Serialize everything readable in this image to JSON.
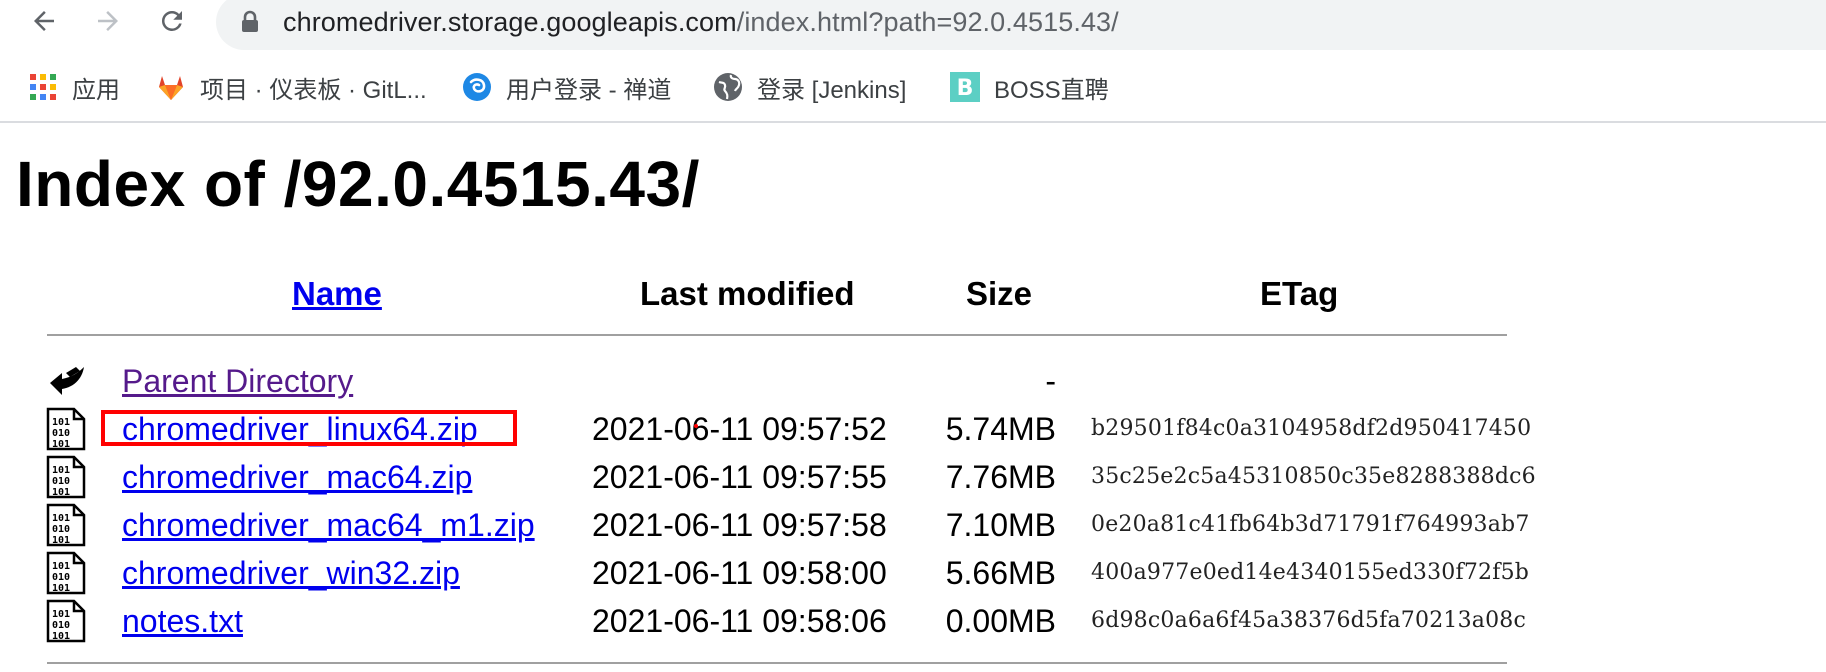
{
  "toolbar": {
    "back_icon": "arrow-left-icon",
    "forward_icon": "arrow-right-icon",
    "reload_icon": "reload-icon",
    "lock_icon": "lock-icon",
    "url_host": "chromedriver.storage.googleapis.com",
    "url_path": "/index.html?path=92.0.4515.43/"
  },
  "bookmarks": [
    {
      "label": "应用",
      "icon": "apps-grid-icon"
    },
    {
      "label": "项目 · 仪表板 · GitL...",
      "icon": "gitlab-icon"
    },
    {
      "label": "用户登录 - 禅道",
      "icon": "zentao-icon"
    },
    {
      "label": "登录 [Jenkins]",
      "icon": "globe-icon"
    },
    {
      "label": "BOSS直聘",
      "icon": "boss-icon"
    }
  ],
  "page": {
    "title": "Index of /92.0.4515.43/",
    "columns": {
      "name": "Name",
      "modified": "Last modified",
      "size": "Size",
      "etag": "ETag"
    },
    "parent": {
      "label": "Parent Directory",
      "size": "-",
      "icon": "back-folder-icon"
    },
    "files": [
      {
        "name": "chromedriver_linux64.zip",
        "modified": "2021-06-11 09:57:52",
        "size": "5.74MB",
        "etag": "b29501f84c0a3104958df2d950417450",
        "icon": "binary-file-icon"
      },
      {
        "name": "chromedriver_mac64.zip",
        "modified": "2021-06-11 09:57:55",
        "size": "7.76MB",
        "etag": "35c25e2c5a45310850c35e8288388dc6",
        "icon": "binary-file-icon"
      },
      {
        "name": "chromedriver_mac64_m1.zip",
        "modified": "2021-06-11 09:57:58",
        "size": "7.10MB",
        "etag": "0e20a81c41fb64b3d71791f764993ab7",
        "icon": "binary-file-icon"
      },
      {
        "name": "chromedriver_win32.zip",
        "modified": "2021-06-11 09:58:00",
        "size": "5.66MB",
        "etag": "400a977e0ed14e4340155ed330f72f5b",
        "icon": "binary-file-icon"
      },
      {
        "name": "notes.txt",
        "modified": "2021-06-11 09:58:06",
        "size": "0.00MB",
        "etag": "6d98c0a6a6f45a38376d5fa70213a08c",
        "icon": "binary-file-icon"
      }
    ],
    "highlight_color": "#ff0000"
  }
}
